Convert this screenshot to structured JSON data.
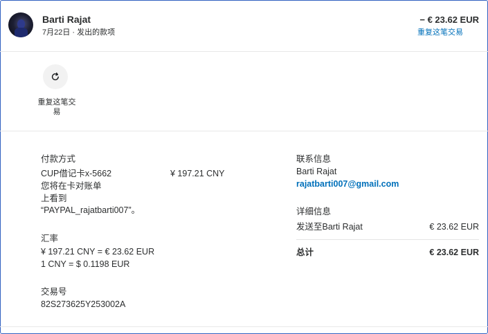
{
  "header": {
    "name": "Barti Rajat",
    "subtitle": "7月22日 · 发出的款项",
    "amount": "− € 23.62 EUR",
    "repeat_link": "重复这笔交易"
  },
  "actions": {
    "repeat_label": "重复这笔交易"
  },
  "payment": {
    "title": "付款方式",
    "method": "CUP借记卡x-5662",
    "amount": "¥ 197.21 CNY",
    "note_lines": [
      "您将在卡对账单",
      "上看到",
      "“PAYPAL_rajatbarti007”。"
    ]
  },
  "exchange": {
    "title": "汇率",
    "line1": "¥ 197.21 CNY = € 23.62 EUR",
    "line2": "1 CNY = $ 0.1198 EUR"
  },
  "transaction": {
    "title": "交易号",
    "id": "82S273625Y253002A"
  },
  "contact": {
    "title": "联系信息",
    "name": "Barti Rajat",
    "email": "rajatbarti007@gmail.com"
  },
  "details": {
    "title": "详细信息",
    "sent_to_label": "发送至Barti Rajat",
    "sent_to_amount": "€ 23.62 EUR",
    "total_label": "总计",
    "total_amount": "€ 23.62 EUR"
  },
  "icons": {
    "repeat": "refresh-icon",
    "avatar": "user-avatar"
  },
  "colors": {
    "link": "#0070ba",
    "border_accent": "#2f5fc0"
  }
}
